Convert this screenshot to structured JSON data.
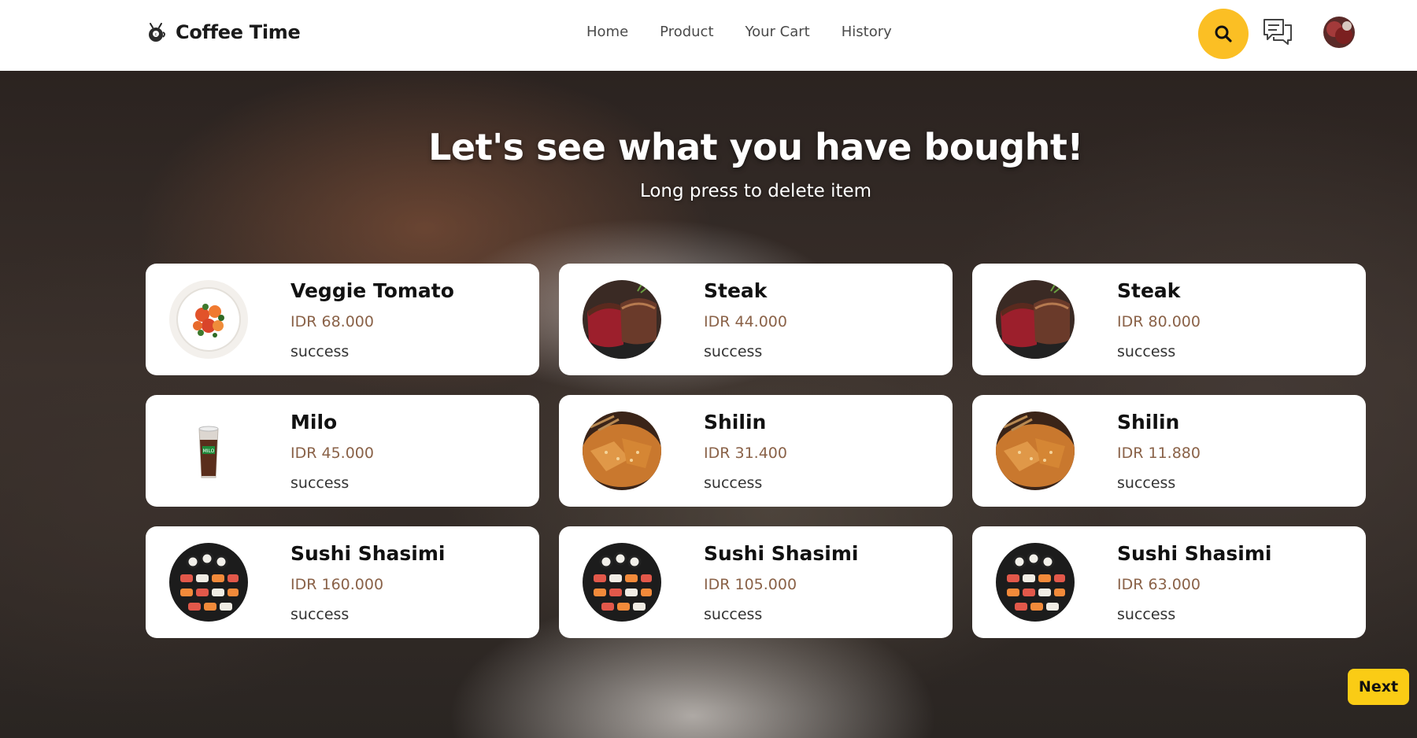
{
  "app": {
    "name": "Coffee Time"
  },
  "nav": [
    {
      "label": "Home"
    },
    {
      "label": "Product"
    },
    {
      "label": "Your Cart"
    },
    {
      "label": "History"
    }
  ],
  "header": {
    "search_icon": "search-icon",
    "chat_icon": "chat-bubbles-icon"
  },
  "hero": {
    "title": "Let's see what you have bought!",
    "subtitle": "Long press to delete item"
  },
  "items": [
    {
      "name": "Veggie Tomato",
      "price": "IDR 68.000",
      "status": "success",
      "image": "veggie-tomato-plate"
    },
    {
      "name": "Steak",
      "price": "IDR 44.000",
      "status": "success",
      "image": "steak"
    },
    {
      "name": "Steak",
      "price": "IDR 80.000",
      "status": "success",
      "image": "steak"
    },
    {
      "name": "Milo",
      "price": "IDR 45.000",
      "status": "success",
      "image": "milo-iced-drink"
    },
    {
      "name": "Shilin",
      "price": "IDR 31.400",
      "status": "success",
      "image": "shilin-chicken"
    },
    {
      "name": "Shilin",
      "price": "IDR 11.880",
      "status": "success",
      "image": "shilin-chicken"
    },
    {
      "name": "Sushi Shasimi",
      "price": "IDR 160.000",
      "status": "success",
      "image": "sushi-platter"
    },
    {
      "name": "Sushi Shasimi",
      "price": "IDR 105.000",
      "status": "success",
      "image": "sushi-platter"
    },
    {
      "name": "Sushi Shasimi",
      "price": "IDR 63.000",
      "status": "success",
      "image": "sushi-platter"
    }
  ],
  "pagination": {
    "next_label": "Next"
  },
  "colors": {
    "accent": "#fbbf24",
    "price": "#8a6248",
    "card_bg": "#ffffff",
    "header_bg": "#ffffff"
  }
}
